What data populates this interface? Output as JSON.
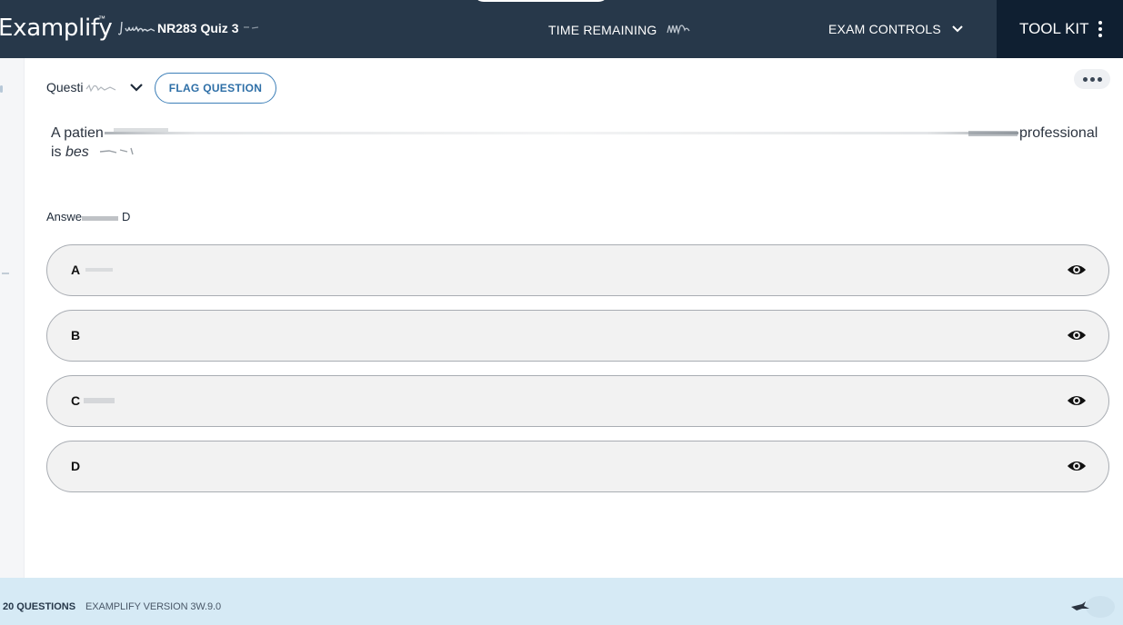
{
  "header": {
    "brand": "Examplify",
    "brand_tm": "™",
    "exam_title": "NR283 Quiz 3",
    "time_label": "TIME REMAINING",
    "exam_controls_label": "EXAM CONTROLS",
    "toolkit_label": "TOOL KIT"
  },
  "question": {
    "selector_label": "Questi",
    "flag_label": "FLAG QUESTION",
    "line1_start": "A patien",
    "line1_end": "professional",
    "line2_start": "is ",
    "line2_italic": "bes",
    "answer_label_start": "Answe",
    "answer_label_end": "D"
  },
  "options": [
    {
      "letter": "A"
    },
    {
      "letter": "B"
    },
    {
      "letter": "C"
    },
    {
      "letter": "D"
    }
  ],
  "footer": {
    "question_count": "20 QUESTIONS",
    "version": "EXAMPLIFY VERSION 3W.9.0"
  },
  "colors": {
    "header_bg": "#27384a",
    "toolkit_bg": "#0f1f31",
    "accent": "#3d7fb8",
    "footer_bg": "#d6eaf5",
    "option_bg": "#f2f2f2"
  }
}
